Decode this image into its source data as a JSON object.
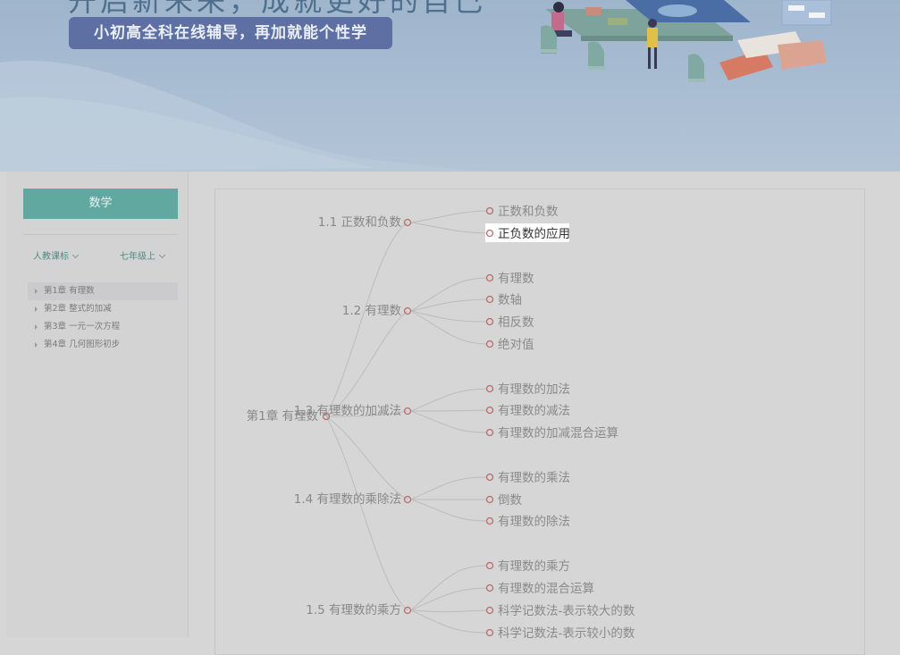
{
  "banner": {
    "headline": "开启新未来，成就更好的自己",
    "tagline": "小初高全科在线辅导，再加就能个性学"
  },
  "sidebar": {
    "subject_button": "数学",
    "textbook_select": "人教课标",
    "grade_select": "七年级上",
    "chapters": [
      {
        "label": "第1章 有理数",
        "active": true
      },
      {
        "label": "第2章 整式的加减",
        "active": false
      },
      {
        "label": "第3章 一元一次方程",
        "active": false
      },
      {
        "label": "第4章 几何图形初步",
        "active": false
      }
    ]
  },
  "mindmap": {
    "root": "第1章 有理数",
    "sections": [
      {
        "label": "1.1 正数和负数",
        "leaves": [
          "正数和负数",
          "正负数的应用"
        ]
      },
      {
        "label": "1.2 有理数",
        "leaves": [
          "有理数",
          "数轴",
          "相反数",
          "绝对值"
        ]
      },
      {
        "label": "1.3 有理数的加减法",
        "leaves": [
          "有理数的加法",
          "有理数的减法",
          "有理数的加减混合运算"
        ]
      },
      {
        "label": "1.4 有理数的乘除法",
        "leaves": [
          "有理数的乘法",
          "倒数",
          "有理数的除法"
        ]
      },
      {
        "label": "1.5 有理数的乘方",
        "leaves": [
          "有理数的乘方",
          "有理数的混合运算",
          "科学记数法-表示较大的数",
          "科学记数法-表示较小的数"
        ]
      }
    ],
    "highlighted_leaf": "正负数的应用"
  },
  "colors": {
    "subject_button": "#61a9a0",
    "node_circle": "#b86b6b",
    "banner_pill": "#5d6fa3"
  }
}
